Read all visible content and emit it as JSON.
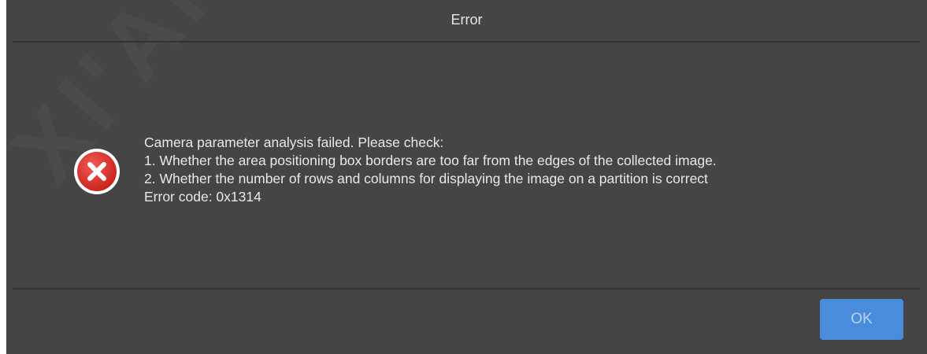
{
  "dialog": {
    "title": "Error",
    "icon": "error-x-icon",
    "message_lines": [
      "Camera parameter analysis failed. Please check:",
      "1. Whether the area positioning box borders are too far from the edges of the collected image.",
      "2. Whether the number of rows and columns for displaying the image on a partition is correct",
      "Error code: 0x1314"
    ],
    "ok_label": "OK",
    "watermark": "XI'AN NOVAS"
  },
  "colors": {
    "dialog_background": "#454545",
    "title_text": "#e6e6e6",
    "message_text": "#e8e8e8",
    "divider": "#333333",
    "error_icon": "#e0302b",
    "ok_button": "#4a8cdc",
    "ok_button_text": "#b9d1ef"
  }
}
